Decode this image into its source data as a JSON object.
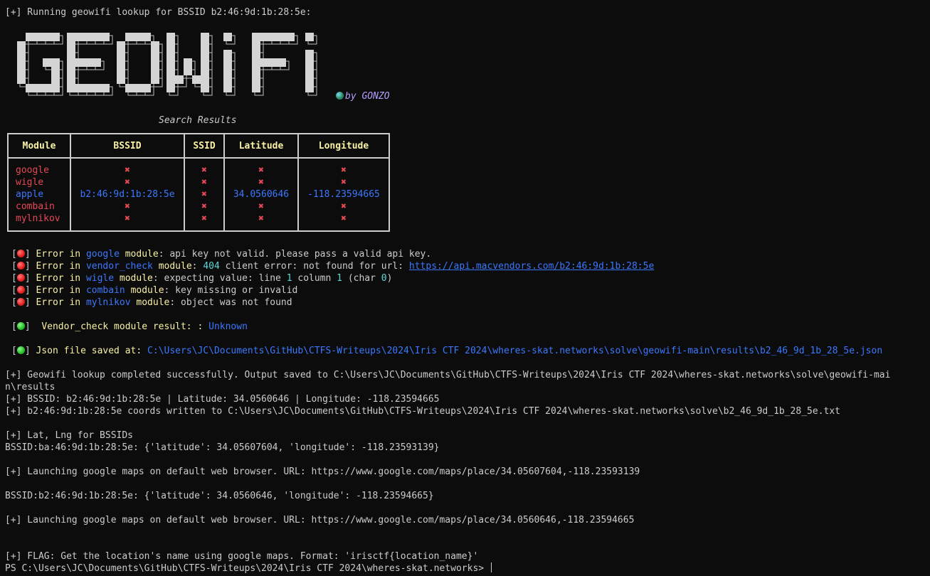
{
  "header_line": "[+] Running geowifi lookup for BSSID b2:46:9d:1b:28:5e:",
  "banner": {
    "letters": [
      "G",
      "E",
      "O",
      "W",
      "i",
      "F",
      "i"
    ],
    "byline": "by GONZO",
    "globe_icon": "globe-icon"
  },
  "table": {
    "title": "Search Results",
    "headers": [
      "Module",
      "BSSID",
      "SSID",
      "Latitude",
      "Longitude"
    ],
    "rows": [
      {
        "module": "google",
        "bssid": "✖",
        "ssid": "✖",
        "latitude": "✖",
        "longitude": "✖",
        "status": "fail"
      },
      {
        "module": "wigle",
        "bssid": "✖",
        "ssid": "✖",
        "latitude": "✖",
        "longitude": "✖",
        "status": "fail"
      },
      {
        "module": "apple",
        "bssid": "b2:46:9d:1b:28:5e",
        "ssid": "✖",
        "latitude": "34.0560646",
        "longitude": "-118.23594665",
        "status": "ok"
      },
      {
        "module": "combain",
        "bssid": "✖",
        "ssid": "✖",
        "latitude": "✖",
        "longitude": "✖",
        "status": "fail"
      },
      {
        "module": "mylnikov",
        "bssid": "✖",
        "ssid": "✖",
        "latitude": "✖",
        "longitude": "✖",
        "status": "fail"
      }
    ]
  },
  "errors": [
    {
      "prefix": "Error in",
      "module": "google",
      "suffix": "module",
      "message": ": api key not valid. please pass a valid api key."
    },
    {
      "prefix": "Error in",
      "module": "vendor_check",
      "suffix": "module",
      "message_pre": ": ",
      "code": "404",
      "message": " client error: not found for url: ",
      "url": "https://api.macvendors.com/b2:46:9d:1b:28:5e"
    },
    {
      "prefix": "Error in",
      "module": "wigle",
      "suffix": "module",
      "message": ": expecting value: line ",
      "n1": "1",
      "m2": " column ",
      "n2": "1",
      "m3": " (char ",
      "n3": "0",
      "m4": ")"
    },
    {
      "prefix": "Error in",
      "module": "combain",
      "suffix": "module",
      "message": ": key missing or invalid"
    },
    {
      "prefix": "Error in",
      "module": "mylnikov",
      "suffix": "module",
      "message": ": object was not found"
    }
  ],
  "vendor_result": {
    "label": "Vendor_check module result: : ",
    "value": "Unknown"
  },
  "json_saved": {
    "label": "Json file saved at: ",
    "path": "C:\\Users\\JC\\Documents\\GitHub\\CTFS-Writeups\\2024\\Iris CTF 2024\\wheres-skat.networks\\solve\\geowifi-main\\results\\b2_46_9d_1b_28_5e.json"
  },
  "output_lines": [
    "[+] Geowifi lookup completed successfully. Output saved to C:\\Users\\JC\\Documents\\GitHub\\CTFS-Writeups\\2024\\Iris CTF 2024\\wheres-skat.networks\\solve\\geowifi-mai",
    "n\\results",
    "[+] BSSID: b2:46:9d:1b:28:5e | Latitude: 34.0560646 | Longitude: -118.23594665",
    "[+] b2:46:9d:1b:28:5e coords written to C:\\Users\\JC\\Documents\\GitHub\\CTFS-Writeups\\2024\\Iris CTF 2024\\wheres-skat.networks\\solve\\b2_46_9d_1b_28_5e.txt",
    "[+] Lat, Lng for BSSIDs",
    "BSSID:ba:46:9d:1b:28:5e: {'latitude': 34.05607604, 'longitude': -118.23593139}",
    "[+] Launching google maps on default web browser. URL: https://www.google.com/maps/place/34.05607604,-118.23593139",
    "BSSID:b2:46:9d:1b:28:5e: {'latitude': 34.0560646, 'longitude': -118.23594665}",
    "[+] Launching google maps on default web browser. URL: https://www.google.com/maps/place/34.0560646,-118.23594665",
    "[+] FLAG: Get the location's name using google maps. Format: 'irisctf{location_name}'"
  ],
  "prompt": "PS C:\\Users\\JC\\Documents\\GitHub\\CTFS-Writeups\\2024\\Iris CTF 2024\\wheres-skat.networks> ",
  "colors": {
    "background": "#0c0c0c",
    "text": "#cccccc",
    "yellow": "#f9f1a5",
    "blue": "#3b78ff",
    "red": "#e74856",
    "cyan": "#61d6d6",
    "purple": "#b4a0ff"
  }
}
